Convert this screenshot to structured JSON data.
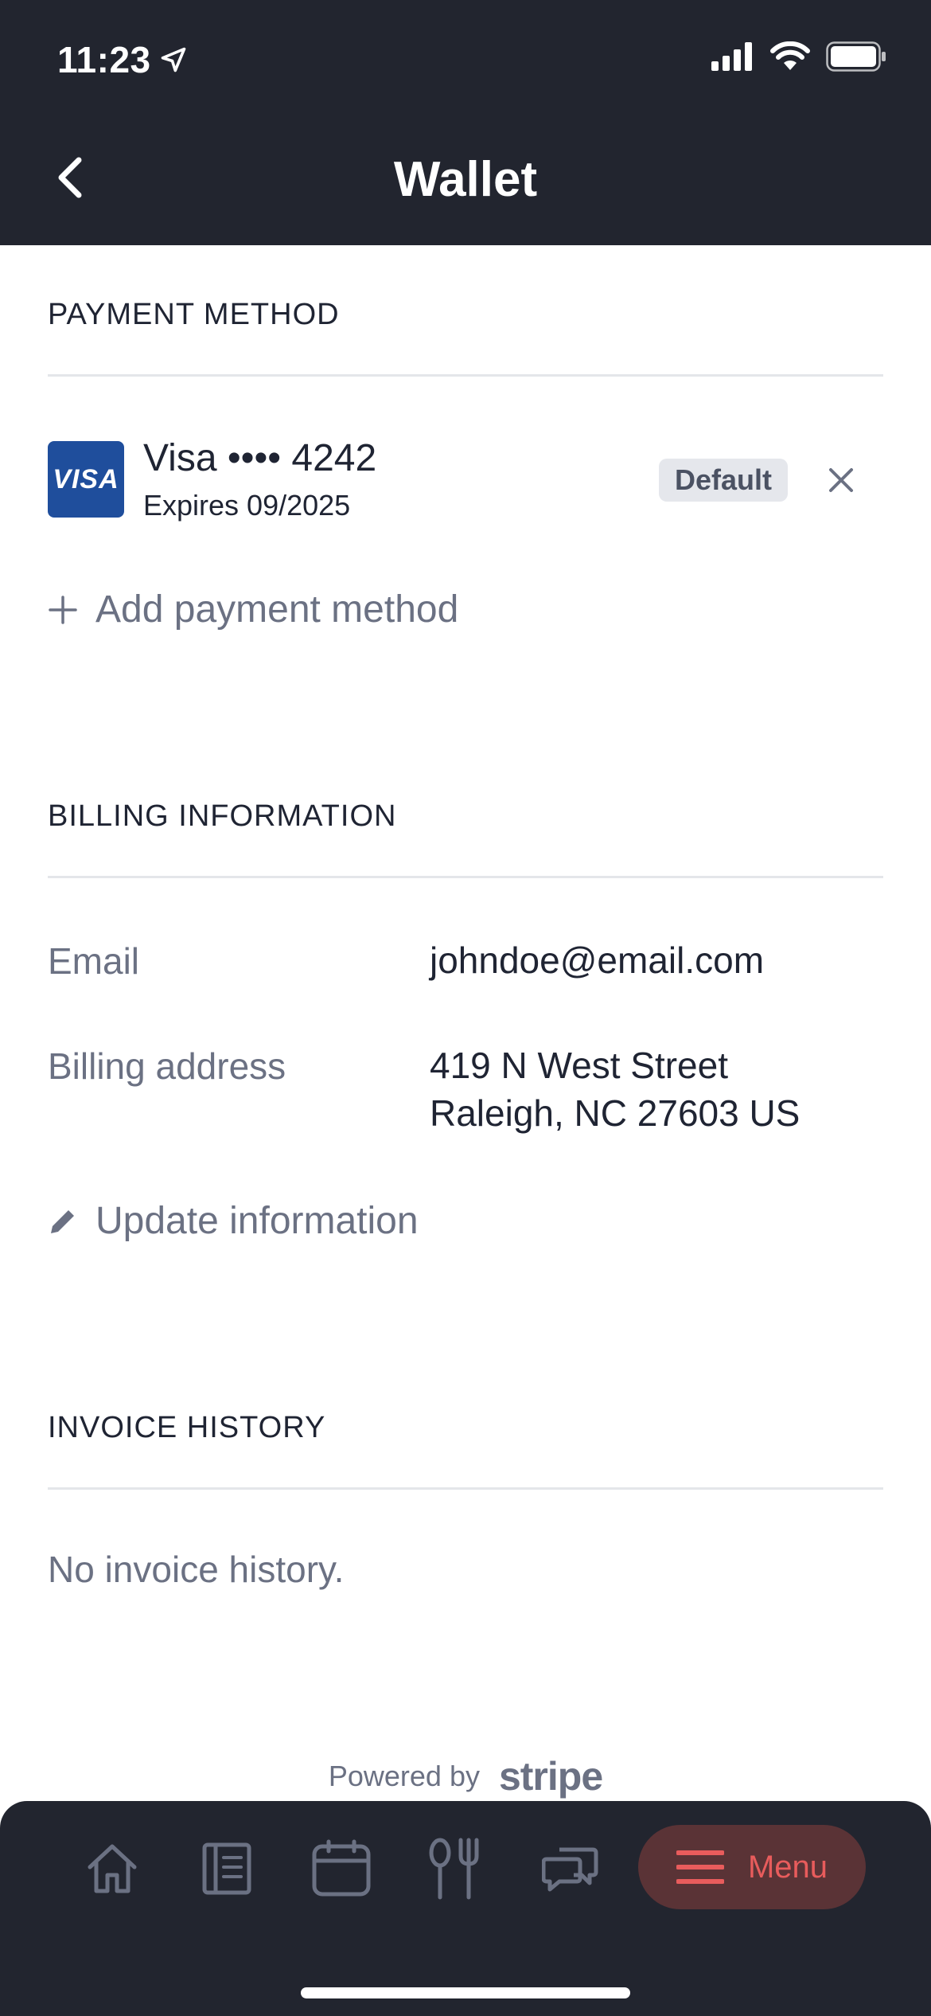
{
  "status_bar": {
    "time": "11:23"
  },
  "header": {
    "title": "Wallet"
  },
  "payment_method": {
    "section_title": "PAYMENT METHOD",
    "card": {
      "brand_logo_text": "VISA",
      "name": "Visa •••• 4242",
      "expiry": "Expires 09/2025",
      "badge": "Default"
    },
    "add_label": "Add payment method"
  },
  "billing": {
    "section_title": "BILLING INFORMATION",
    "email_label": "Email",
    "email_value": "johndoe@email.com",
    "address_label": "Billing address",
    "address_line1": "419 N West Street",
    "address_line2": "Raleigh, NC 27603 US",
    "update_label": "Update information"
  },
  "invoice": {
    "section_title": "INVOICE HISTORY",
    "empty_text": "No invoice history."
  },
  "footer": {
    "powered_by": "Powered by",
    "brand": "stripe"
  },
  "bottom_nav": {
    "items": [
      "home-icon",
      "news-icon",
      "calendar-icon",
      "dining-icon",
      "chat-icon"
    ],
    "menu_label": "Menu"
  },
  "colors": {
    "header_bg": "#22252f",
    "accent": "#e85c5c",
    "visa_blue": "#1f4e9c"
  }
}
